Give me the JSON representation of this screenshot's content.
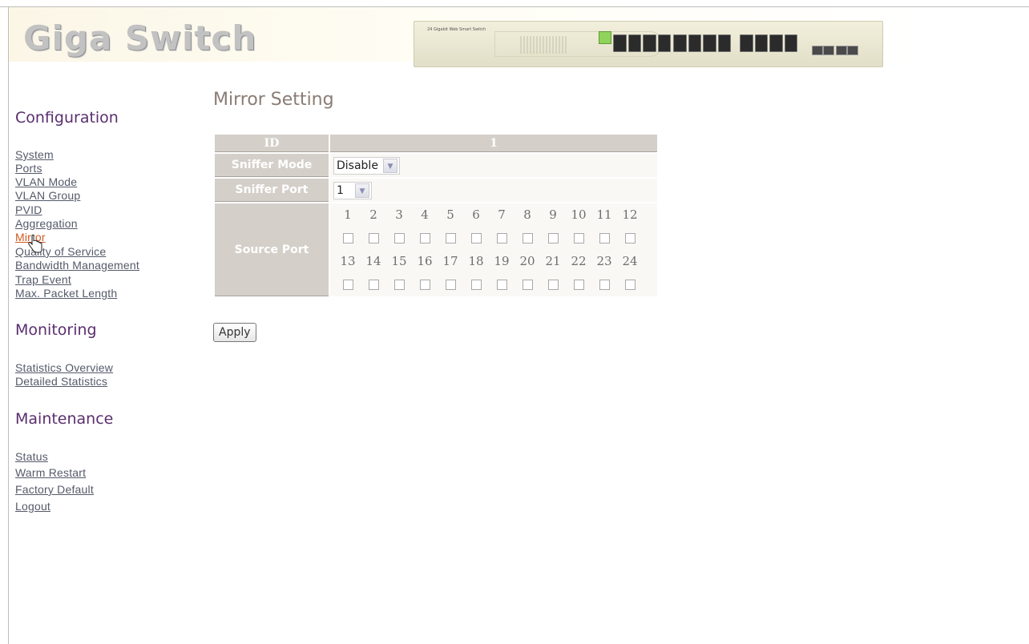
{
  "header": {
    "logo": "Giga Switch",
    "device_model_label": "24 Gigabit Web Smart Switch"
  },
  "sidebar": {
    "sections": [
      {
        "title": "Configuration",
        "items": [
          "System",
          "Ports",
          "VLAN Mode",
          "VLAN Group",
          "PVID",
          "Aggregation",
          "Mirror",
          "Quality of Service",
          "Bandwidth Management",
          "Trap Event",
          "Max. Packet Length"
        ]
      },
      {
        "title": "Monitoring",
        "items": [
          "Statistics Overview",
          "Detailed Statistics"
        ]
      },
      {
        "title": "Maintenance",
        "items": [
          "Status",
          "Warm Restart",
          "Factory Default",
          "Logout"
        ]
      }
    ],
    "active_item": "Mirror"
  },
  "main": {
    "title": "Mirror Setting",
    "table": {
      "id_header": "ID",
      "id_value": "1",
      "sniffer_mode_label": "Sniffer Mode",
      "sniffer_mode_value": "Disable",
      "sniffer_port_label": "Sniffer Port",
      "sniffer_port_value": "1",
      "source_port_label": "Source Port",
      "ports_row1": [
        "1",
        "2",
        "3",
        "4",
        "5",
        "6",
        "7",
        "8",
        "9",
        "10",
        "11",
        "12"
      ],
      "ports_row2": [
        "13",
        "14",
        "15",
        "16",
        "17",
        "18",
        "19",
        "20",
        "21",
        "22",
        "23",
        "24"
      ],
      "source_port_checked": []
    },
    "apply_label": "Apply"
  },
  "colors": {
    "accent_purple": "#5a2e6e",
    "active_link": "#d05a24",
    "table_header_bg": "#d4cfc9",
    "title_color": "#8a7c74"
  }
}
